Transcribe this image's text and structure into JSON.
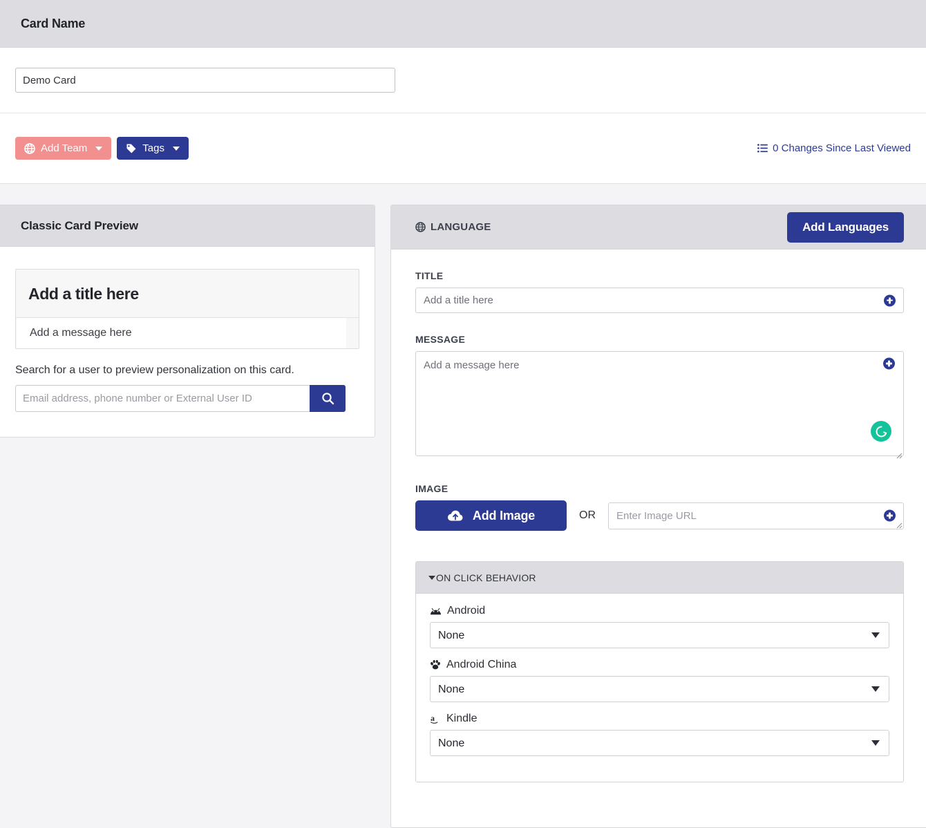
{
  "header": {
    "title": "Card Name",
    "name_value": "Demo Card"
  },
  "toolbar": {
    "add_team_label": "Add Team",
    "tags_label": "Tags",
    "changes_label": "0 Changes Since Last Viewed"
  },
  "preview": {
    "panel_title": "Classic Card Preview",
    "card_title": "Add a title here",
    "card_message": "Add a message here",
    "helper_text": "Search for a user to preview personalization on this card.",
    "search_placeholder": "Email address, phone number or External User ID",
    "search_value": ""
  },
  "editor": {
    "language_label": "LANGUAGE",
    "add_languages_label": "Add Languages",
    "title_label": "TITLE",
    "title_placeholder": "Add a title here",
    "title_value": "",
    "message_label": "MESSAGE",
    "message_placeholder": "Add a message here",
    "message_value": "",
    "image_label": "IMAGE",
    "add_image_label": "Add Image",
    "or_label": "OR",
    "image_url_placeholder": "Enter Image URL",
    "image_url_value": ""
  },
  "on_click_behavior": {
    "section_title": "ON CLICK BEHAVIOR",
    "platforms": [
      {
        "name": "Android",
        "icon": "android-icon",
        "value": "None"
      },
      {
        "name": "Android China",
        "icon": "paw-icon",
        "value": "None"
      },
      {
        "name": "Kindle",
        "icon": "amazon-icon",
        "value": "None"
      }
    ]
  },
  "colors": {
    "navy": "#2d3a94",
    "salmon": "#f2908f",
    "grammarly_green": "#15c39a",
    "panel_header_gray": "#dddde1",
    "page_background": "#f4f4f6"
  }
}
